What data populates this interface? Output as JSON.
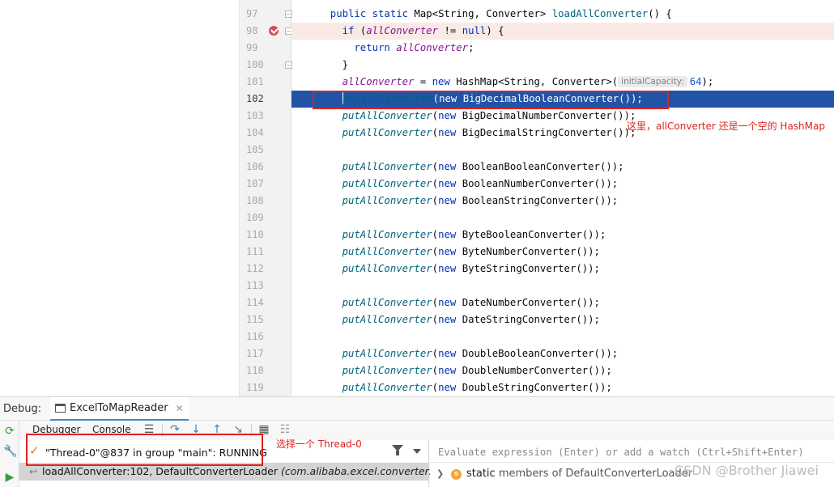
{
  "editor": {
    "lines": [
      {
        "num": "97",
        "tokens": [
          [
            "k",
            "public static "
          ],
          [
            "",
            "Map<String, Converter> "
          ],
          [
            "m",
            "loadAllConverter"
          ],
          [
            "",
            "() {"
          ]
        ],
        "indent": 2,
        "fold": true
      },
      {
        "num": "98",
        "tokens": [
          [
            "k",
            "if "
          ],
          [
            "",
            "("
          ],
          [
            "f",
            "allConverter"
          ],
          [
            "",
            " != "
          ],
          [
            "k",
            "null"
          ],
          [
            "",
            ") {"
          ]
        ],
        "indent": 4,
        "breakpoint": true,
        "fold": true
      },
      {
        "num": "99",
        "tokens": [
          [
            "k",
            "return "
          ],
          [
            "f",
            "allConverter"
          ],
          [
            "",
            ";"
          ]
        ],
        "indent": 6
      },
      {
        "num": "100",
        "tokens": [
          [
            "",
            "}"
          ]
        ],
        "indent": 4,
        "fold": true
      },
      {
        "num": "101",
        "tokens": [
          [
            "f",
            "allConverter"
          ],
          [
            "",
            " = "
          ],
          [
            "k",
            "new "
          ],
          [
            "",
            "HashMap<String, Converter>("
          ],
          [
            "hint",
            "initialCapacity:"
          ],
          [
            "n",
            "64"
          ],
          [
            "",
            ");"
          ]
        ],
        "indent": 4
      },
      {
        "num": "102",
        "tokens": [
          [
            "caret",
            ""
          ],
          [
            "m-it",
            "putAllConverter"
          ],
          [
            "",
            "("
          ],
          [
            "k",
            "new "
          ],
          [
            "",
            "BigDecimalBooleanConverter());"
          ]
        ],
        "indent": 4,
        "exec": true
      },
      {
        "num": "103",
        "tokens": [
          [
            "m-it",
            "putAllConverter"
          ],
          [
            "",
            "("
          ],
          [
            "k",
            "new "
          ],
          [
            "",
            "BigDecimalNumberConverter());"
          ]
        ],
        "indent": 4
      },
      {
        "num": "104",
        "tokens": [
          [
            "m-it",
            "putAllConverter"
          ],
          [
            "",
            "("
          ],
          [
            "k",
            "new "
          ],
          [
            "",
            "BigDecimalStringConverter());"
          ]
        ],
        "indent": 4
      },
      {
        "num": "105",
        "tokens": [],
        "indent": 0
      },
      {
        "num": "106",
        "tokens": [
          [
            "m-it",
            "putAllConverter"
          ],
          [
            "",
            "("
          ],
          [
            "k",
            "new "
          ],
          [
            "",
            "BooleanBooleanConverter());"
          ]
        ],
        "indent": 4
      },
      {
        "num": "107",
        "tokens": [
          [
            "m-it",
            "putAllConverter"
          ],
          [
            "",
            "("
          ],
          [
            "k",
            "new "
          ],
          [
            "",
            "BooleanNumberConverter());"
          ]
        ],
        "indent": 4
      },
      {
        "num": "108",
        "tokens": [
          [
            "m-it",
            "putAllConverter"
          ],
          [
            "",
            "("
          ],
          [
            "k",
            "new "
          ],
          [
            "",
            "BooleanStringConverter());"
          ]
        ],
        "indent": 4
      },
      {
        "num": "109",
        "tokens": [],
        "indent": 0
      },
      {
        "num": "110",
        "tokens": [
          [
            "m-it",
            "putAllConverter"
          ],
          [
            "",
            "("
          ],
          [
            "k",
            "new "
          ],
          [
            "",
            "ByteBooleanConverter());"
          ]
        ],
        "indent": 4
      },
      {
        "num": "111",
        "tokens": [
          [
            "m-it",
            "putAllConverter"
          ],
          [
            "",
            "("
          ],
          [
            "k",
            "new "
          ],
          [
            "",
            "ByteNumberConverter());"
          ]
        ],
        "indent": 4
      },
      {
        "num": "112",
        "tokens": [
          [
            "m-it",
            "putAllConverter"
          ],
          [
            "",
            "("
          ],
          [
            "k",
            "new "
          ],
          [
            "",
            "ByteStringConverter());"
          ]
        ],
        "indent": 4
      },
      {
        "num": "113",
        "tokens": [],
        "indent": 0
      },
      {
        "num": "114",
        "tokens": [
          [
            "m-it",
            "putAllConverter"
          ],
          [
            "",
            "("
          ],
          [
            "k",
            "new "
          ],
          [
            "",
            "DateNumberConverter());"
          ]
        ],
        "indent": 4
      },
      {
        "num": "115",
        "tokens": [
          [
            "m-it",
            "putAllConverter"
          ],
          [
            "",
            "("
          ],
          [
            "k",
            "new "
          ],
          [
            "",
            "DateStringConverter());"
          ]
        ],
        "indent": 4
      },
      {
        "num": "116",
        "tokens": [],
        "indent": 0
      },
      {
        "num": "117",
        "tokens": [
          [
            "m-it",
            "putAllConverter"
          ],
          [
            "",
            "("
          ],
          [
            "k",
            "new "
          ],
          [
            "",
            "DoubleBooleanConverter());"
          ]
        ],
        "indent": 4
      },
      {
        "num": "118",
        "tokens": [
          [
            "m-it",
            "putAllConverter"
          ],
          [
            "",
            "("
          ],
          [
            "k",
            "new "
          ],
          [
            "",
            "DoubleNumberConverter());"
          ]
        ],
        "indent": 4
      },
      {
        "num": "119",
        "tokens": [
          [
            "m-it",
            "putAllConverter"
          ],
          [
            "",
            "("
          ],
          [
            "k",
            "new "
          ],
          [
            "",
            "DoubleStringConverter());"
          ]
        ],
        "indent": 4
      }
    ]
  },
  "annotations": {
    "code_note": "这里，allConverter 还是一个空的 HashMap",
    "thread_note": "选择一个 Thread-0"
  },
  "debug": {
    "label": "Debug:",
    "session_tab": "ExcelToMapReader",
    "subtabs": {
      "debugger": "Debugger",
      "console": "Console"
    },
    "thread": "\"Thread-0\"@837 in group \"main\": RUNNING",
    "frame": {
      "method": "loadAllConverter:102, DefaultConverterLoader",
      "package": "(com.alibaba.excel.converters)"
    },
    "eval_placeholder": "Evaluate expression (Enter) or add a watch (Ctrl+Shift+Enter)",
    "static_row": {
      "keyword": "static",
      "rest": " members of DefaultConverterLoader"
    }
  },
  "watermark": "CSDN @Brother Jiawei",
  "colors": {
    "exec_line": "#2154a6",
    "breakpoint": "#db4d4d",
    "annotation_red": "#e0201e"
  }
}
